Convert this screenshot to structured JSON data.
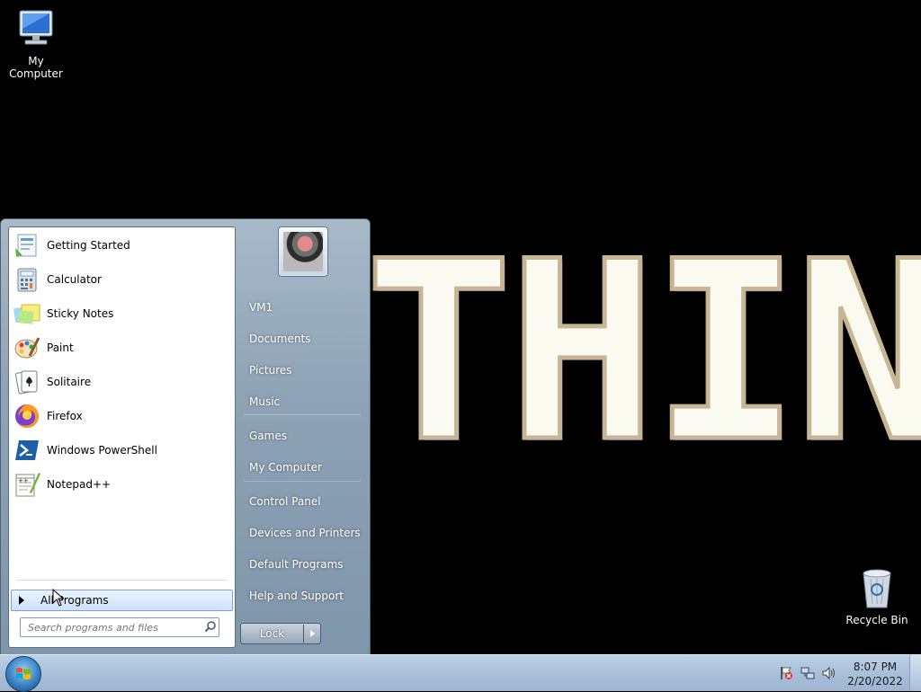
{
  "desktop": {
    "wallpaper_text": "THING",
    "icons": [
      {
        "label": "My Computer",
        "icon": "computer-icon"
      },
      {
        "label": "Recycle Bin",
        "icon": "recycle-bin-icon"
      }
    ]
  },
  "start_menu": {
    "pinned": [
      {
        "label": "Getting Started",
        "icon": "getting-started-icon"
      },
      {
        "label": "Calculator",
        "icon": "calculator-icon"
      },
      {
        "label": "Sticky Notes",
        "icon": "sticky-notes-icon"
      },
      {
        "label": "Paint",
        "icon": "paint-icon"
      },
      {
        "label": "Solitaire",
        "icon": "solitaire-icon"
      },
      {
        "label": "Firefox",
        "icon": "firefox-icon"
      },
      {
        "label": "Windows PowerShell",
        "icon": "powershell-icon"
      },
      {
        "label": "Notepad++",
        "icon": "notepadpp-icon"
      }
    ],
    "all_programs": "All Programs",
    "search_placeholder": "Search programs and files",
    "right_links": [
      {
        "label": "VM1"
      },
      {
        "label": "Documents"
      },
      {
        "label": "Pictures"
      },
      {
        "label": "Music"
      },
      {
        "label": "Games"
      },
      {
        "label": "My Computer"
      },
      {
        "label": "Control Panel"
      },
      {
        "label": "Devices and Printers"
      },
      {
        "label": "Default Programs"
      },
      {
        "label": "Help and Support"
      }
    ],
    "lock_label": "Lock"
  },
  "taskbar": {
    "time": "8:07 PM",
    "date": "2/20/2022",
    "tray_icons": [
      "action-center-flag-icon",
      "network-icon",
      "volume-icon"
    ]
  }
}
